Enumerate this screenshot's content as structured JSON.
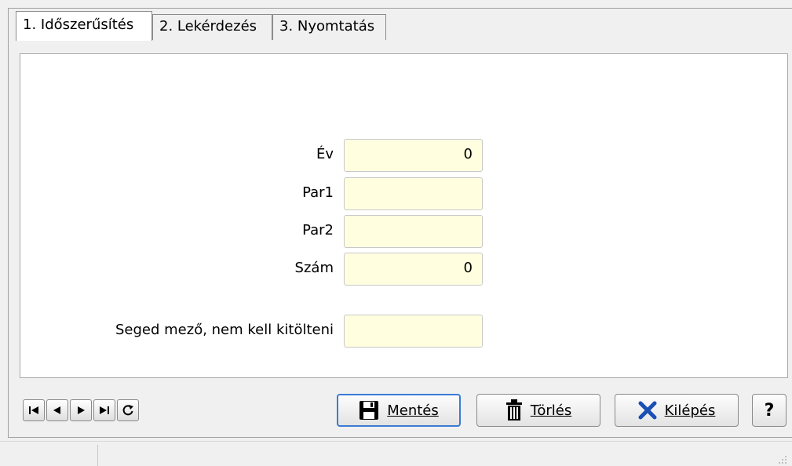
{
  "tabs": [
    {
      "label": "1. Időszerűsítés"
    },
    {
      "label": "2. Lekérdezés"
    },
    {
      "label": "3. Nyomtatás"
    }
  ],
  "form": {
    "ev_label": "Év",
    "ev_value": "0",
    "par1_label": "Par1",
    "par1_value": "",
    "par2_label": "Par2",
    "par2_value": "",
    "szam_label": "Szám",
    "szam_value": "0",
    "seged_label": "Seged mező, nem kell kitölteni",
    "seged_value": ""
  },
  "toolbar": {
    "save_label": "Mentés",
    "delete_label": "Törlés",
    "exit_label": "Kilépés",
    "help_label": "?"
  },
  "colors": {
    "field_bg": "#ffffe0",
    "save_border": "#3a7bd5",
    "exit_icon": "#1a4fb5"
  }
}
